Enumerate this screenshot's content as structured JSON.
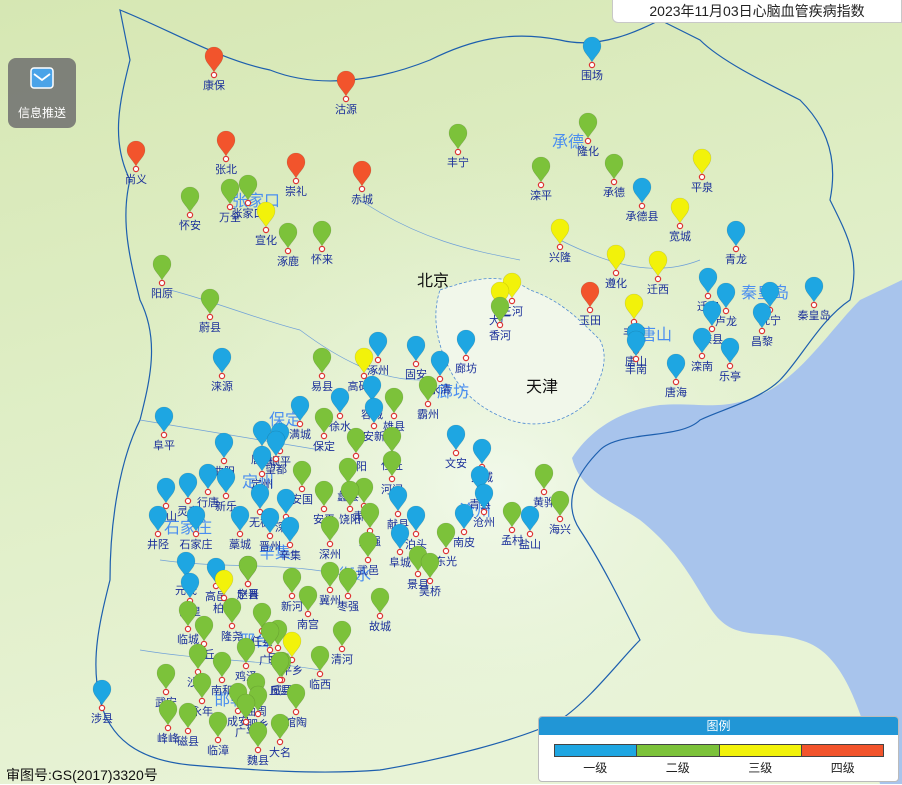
{
  "title": "2023年11月03日心脑血管疾病指数",
  "info_button": {
    "label": "信息推送",
    "icon": "mail-icon"
  },
  "approval": "审图号:GS(2017)3320号",
  "legend": {
    "title": "图例",
    "levels": [
      {
        "label": "一级",
        "color": "#1ea6e2"
      },
      {
        "label": "二级",
        "color": "#7cc23a"
      },
      {
        "label": "三级",
        "color": "#f2f20a"
      },
      {
        "label": "四级",
        "color": "#f2542c"
      }
    ]
  },
  "cities": [
    {
      "name": "北京"
    },
    {
      "name": "天津"
    }
  ],
  "regions": [
    {
      "name": "承德"
    },
    {
      "name": "张家口"
    },
    {
      "name": "秦皇岛"
    },
    {
      "name": "唐山"
    },
    {
      "name": "廊坊"
    },
    {
      "name": "保定"
    },
    {
      "name": "沧州"
    },
    {
      "name": "石家庄"
    },
    {
      "name": "衡水"
    },
    {
      "name": "邢台"
    },
    {
      "name": "邯郸"
    },
    {
      "name": "定州"
    },
    {
      "name": "辛集"
    }
  ],
  "stations": [
    {
      "name": "康保",
      "level": 4
    },
    {
      "name": "沽源",
      "level": 4
    },
    {
      "name": "围场",
      "level": 1
    },
    {
      "name": "尚义",
      "level": 4
    },
    {
      "name": "张北",
      "level": 4
    },
    {
      "name": "崇礼",
      "level": 4
    },
    {
      "name": "赤城",
      "level": 4
    },
    {
      "name": "丰宁",
      "level": 2
    },
    {
      "name": "隆化",
      "level": 2
    },
    {
      "name": "滦平",
      "level": 2
    },
    {
      "name": "承德",
      "level": 2
    },
    {
      "name": "平泉",
      "level": 3
    },
    {
      "name": "承德县",
      "level": 1
    },
    {
      "name": "宽城",
      "level": 3
    },
    {
      "name": "青龙",
      "level": 1
    },
    {
      "name": "怀安",
      "level": 2
    },
    {
      "name": "万全",
      "level": 2
    },
    {
      "name": "张家口",
      "level": 2
    },
    {
      "name": "宣化",
      "level": 3
    },
    {
      "name": "涿鹿",
      "level": 2
    },
    {
      "name": "怀来",
      "level": 2
    },
    {
      "name": "兴隆",
      "level": 3
    },
    {
      "name": "遵化",
      "level": 3
    },
    {
      "name": "迁西",
      "level": 3
    },
    {
      "name": "迁安",
      "level": 1
    },
    {
      "name": "卢龙",
      "level": 1
    },
    {
      "name": "抚宁",
      "level": 1
    },
    {
      "name": "秦皇岛",
      "level": 1
    },
    {
      "name": "昌黎",
      "level": 1
    },
    {
      "name": "阳原",
      "level": 2
    },
    {
      "name": "蔚县",
      "level": 2
    },
    {
      "name": "玉田",
      "level": 4
    },
    {
      "name": "三河",
      "level": 3
    },
    {
      "name": "大厂",
      "level": 3
    },
    {
      "name": "香河",
      "level": 2
    },
    {
      "name": "丰润",
      "level": 3
    },
    {
      "name": "唐山",
      "level": 1
    },
    {
      "name": "滦县",
      "level": 1
    },
    {
      "name": "丰南",
      "level": 1
    },
    {
      "name": "滦南",
      "level": 1
    },
    {
      "name": "乐亭",
      "level": 1
    },
    {
      "name": "唐海",
      "level": 1
    },
    {
      "name": "涞源",
      "level": 1
    },
    {
      "name": "易县",
      "level": 2
    },
    {
      "name": "涿州",
      "level": 1
    },
    {
      "name": "固安",
      "level": 1
    },
    {
      "name": "廊坊",
      "level": 1
    },
    {
      "name": "高碑店",
      "level": 3
    },
    {
      "name": "永清",
      "level": 1
    },
    {
      "name": "徐水",
      "level": 1
    },
    {
      "name": "容城",
      "level": 1
    },
    {
      "name": "雄县",
      "level": 2
    },
    {
      "name": "霸州",
      "level": 2
    },
    {
      "name": "文安",
      "level": 1
    },
    {
      "name": "大城",
      "level": 1
    },
    {
      "name": "阜平",
      "level": 1
    },
    {
      "name": "满城",
      "level": 1
    },
    {
      "name": "保定",
      "level": 2
    },
    {
      "name": "安新",
      "level": 1
    },
    {
      "name": "任丘",
      "level": 2
    },
    {
      "name": "曲阳",
      "level": 1
    },
    {
      "name": "唐县",
      "level": 1
    },
    {
      "name": "顺平",
      "level": 1
    },
    {
      "name": "望都",
      "level": 1
    },
    {
      "name": "高阳",
      "level": 2
    },
    {
      "name": "河间",
      "level": 2
    },
    {
      "name": "青县",
      "level": 1
    },
    {
      "name": "黄骅",
      "level": 2
    },
    {
      "name": "沧州",
      "level": 1
    },
    {
      "name": "定州",
      "level": 1
    },
    {
      "name": "安国",
      "level": 2
    },
    {
      "name": "蠡县",
      "level": 2
    },
    {
      "name": "肃宁",
      "level": 2
    },
    {
      "name": "平山",
      "level": 1
    },
    {
      "name": "灵寿",
      "level": 1
    },
    {
      "name": "行唐",
      "level": 1
    },
    {
      "name": "新乐",
      "level": 1
    },
    {
      "name": "无极",
      "level": 1
    },
    {
      "name": "深泽",
      "level": 1
    },
    {
      "name": "安平",
      "level": 2
    },
    {
      "name": "饶阳",
      "level": 2
    },
    {
      "name": "献县",
      "level": 1
    },
    {
      "name": "泊头",
      "level": 1
    },
    {
      "name": "南皮",
      "level": 1
    },
    {
      "name": "孟村",
      "level": 2
    },
    {
      "name": "盐山",
      "level": 1
    },
    {
      "name": "海兴",
      "level": 2
    },
    {
      "name": "井陉",
      "level": 1
    },
    {
      "name": "石家庄",
      "level": 1
    },
    {
      "name": "藁城",
      "level": 1
    },
    {
      "name": "晋州",
      "level": 1
    },
    {
      "name": "辛集",
      "level": 1
    },
    {
      "name": "深州",
      "level": 2
    },
    {
      "name": "武强",
      "level": 2
    },
    {
      "name": "武邑",
      "level": 2
    },
    {
      "name": "阜城",
      "level": 1
    },
    {
      "name": "东光",
      "level": 2
    },
    {
      "name": "元氏",
      "level": 1
    },
    {
      "name": "赵县",
      "level": 2
    },
    {
      "name": "宁晋",
      "level": 2
    },
    {
      "name": "新河",
      "level": 2
    },
    {
      "name": "冀州",
      "level": 2
    },
    {
      "name": "枣强",
      "level": 2
    },
    {
      "name": "景县",
      "level": 2
    },
    {
      "name": "吴桥",
      "level": 2
    },
    {
      "name": "赞皇",
      "level": 1
    },
    {
      "name": "临城",
      "level": 2
    },
    {
      "name": "高邑",
      "level": 1
    },
    {
      "name": "柏乡",
      "level": 3
    },
    {
      "name": "隆尧",
      "level": 2
    },
    {
      "name": "南宫",
      "level": 2
    },
    {
      "name": "故城",
      "level": 2
    },
    {
      "name": "内丘",
      "level": 2
    },
    {
      "name": "任县",
      "level": 2
    },
    {
      "name": "巨鹿",
      "level": 2
    },
    {
      "name": "平乡",
      "level": 3
    },
    {
      "name": "广宗",
      "level": 2
    },
    {
      "name": "威县",
      "level": 2
    },
    {
      "name": "清河",
      "level": 2
    },
    {
      "name": "临西",
      "level": 2
    },
    {
      "name": "沙河",
      "level": 2
    },
    {
      "name": "南和",
      "level": 2
    },
    {
      "name": "鸡泽",
      "level": 2
    },
    {
      "name": "丘县",
      "level": 2
    },
    {
      "name": "武安",
      "level": 2
    },
    {
      "name": "永年",
      "level": 2
    },
    {
      "name": "曲周",
      "level": 2
    },
    {
      "name": "涉县",
      "level": 1
    },
    {
      "name": "峰峰",
      "level": 2
    },
    {
      "name": "磁县",
      "level": 2
    },
    {
      "name": "成安",
      "level": 2
    },
    {
      "name": "肥乡",
      "level": 2
    },
    {
      "name": "广平",
      "level": 2
    },
    {
      "name": "馆陶",
      "level": 2
    },
    {
      "name": "临漳",
      "level": 2
    },
    {
      "name": "魏县",
      "level": 2
    },
    {
      "name": "大名",
      "level": 2
    }
  ]
}
